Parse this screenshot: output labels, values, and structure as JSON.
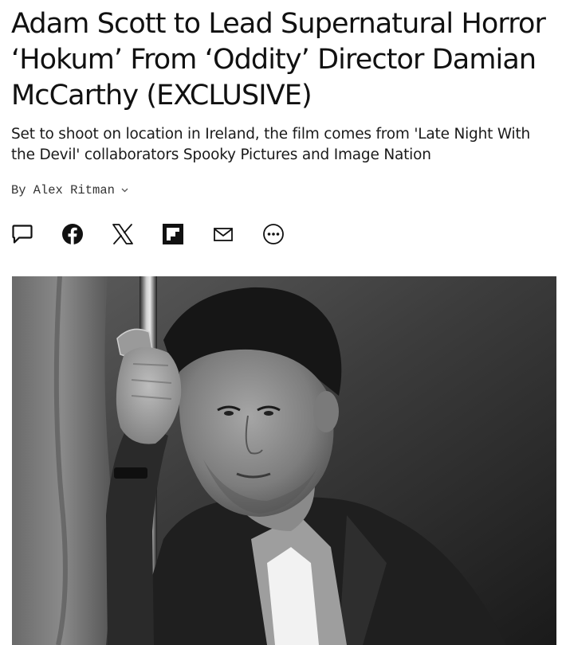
{
  "article": {
    "headline": "Adam Scott to Lead Supernatural Horror ‘Hokum’ From ‘Oddity’ Director Damian McCarthy (EXCLUSIVE)",
    "dek": "Set to shoot on location in Ireland, the film comes from 'Late Night With the Devil' collaborators Spooky Pictures and Image Nation",
    "byline": {
      "prefix": "By",
      "author": "Alex Ritman"
    }
  },
  "share": {
    "icons": [
      "comment-icon",
      "facebook-icon",
      "x-icon",
      "flipboard-icon",
      "email-icon",
      "more-icon"
    ]
  },
  "hero_image": {
    "subject": "black-and-white portrait photo",
    "tone": "monochrome"
  },
  "colors": {
    "text": "#111111",
    "background": "#ffffff"
  }
}
